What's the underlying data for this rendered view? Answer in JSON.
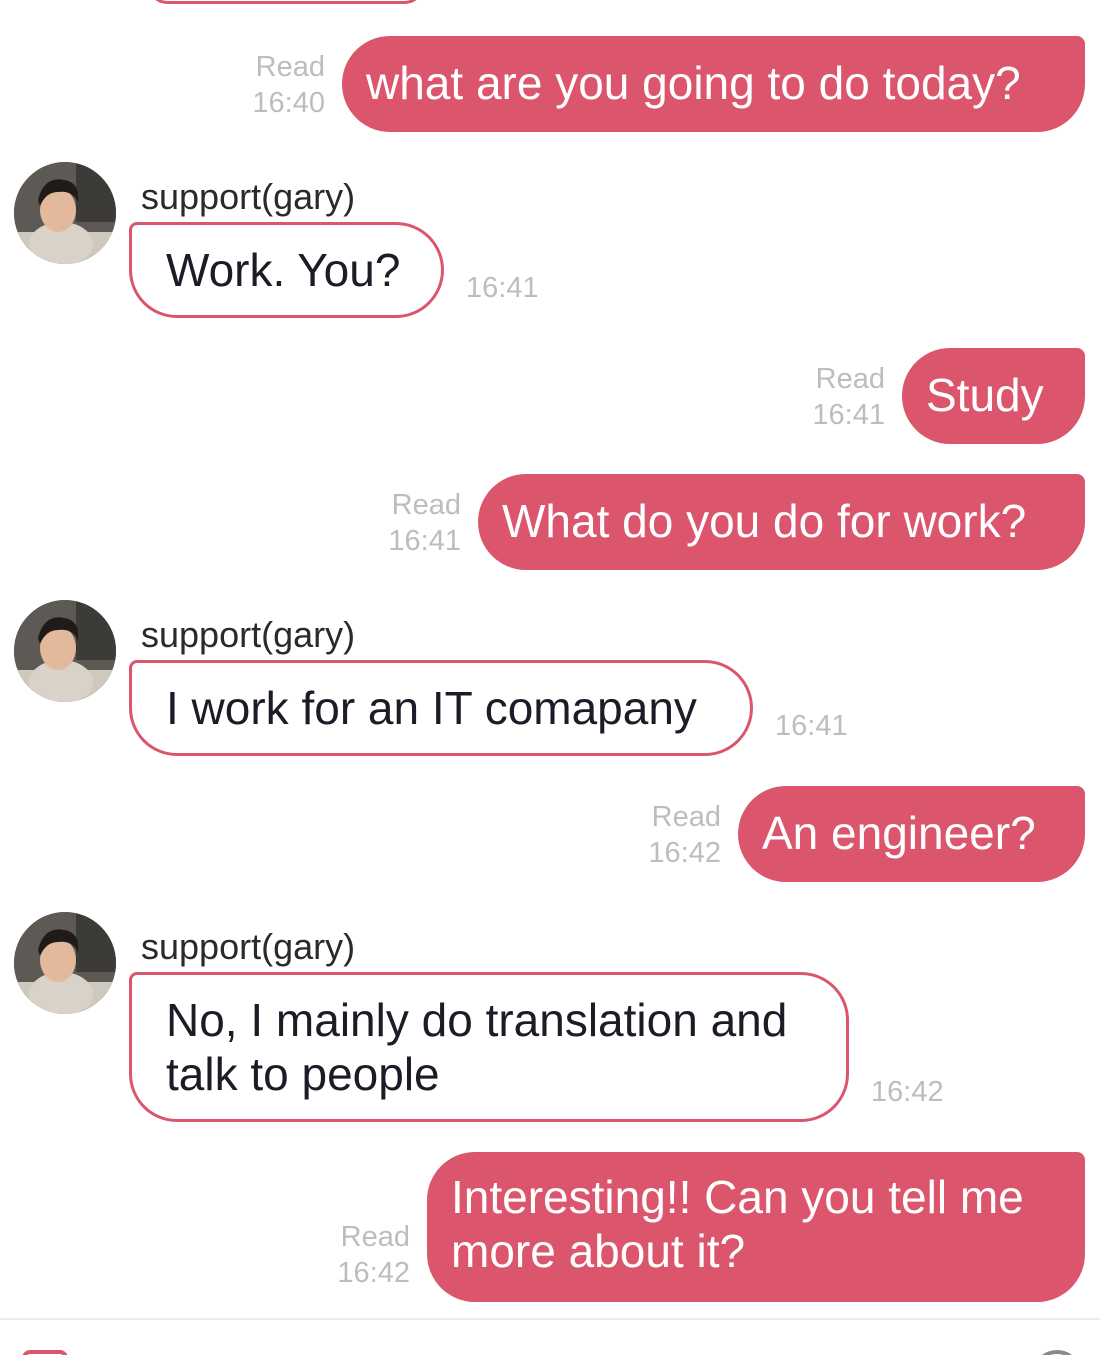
{
  "colors": {
    "accent": "#db566d",
    "outgoing_text": "#ffffff",
    "incoming_text": "#1d1b26",
    "meta_text": "#bdbdbd"
  },
  "messages": [
    {
      "direction": "out",
      "status": "Read",
      "time": "16:40",
      "text": "what are you going to do today?"
    },
    {
      "direction": "in",
      "sender": "support(gary)",
      "time": "16:41",
      "text": "Work. You?"
    },
    {
      "direction": "out",
      "status": "Read",
      "time": "16:41",
      "text": "Study"
    },
    {
      "direction": "out",
      "status": "Read",
      "time": "16:41",
      "text": "What do you do for work?"
    },
    {
      "direction": "in",
      "sender": "support(gary)",
      "time": "16:41",
      "text": "I work for an IT comapany"
    },
    {
      "direction": "out",
      "status": "Read",
      "time": "16:42",
      "text": "An engineer?"
    },
    {
      "direction": "in",
      "sender": "support(gary)",
      "time": "16:42",
      "text": "No, I mainly do translation and talk to people"
    },
    {
      "direction": "out",
      "status": "Read",
      "time": "16:42",
      "text": "Interesting!! Can you tell me more about it?"
    }
  ],
  "icons": {
    "avatar": "avatar-photo",
    "bottom_left": "sticker-icon",
    "bottom_right": "emoji-icon"
  }
}
